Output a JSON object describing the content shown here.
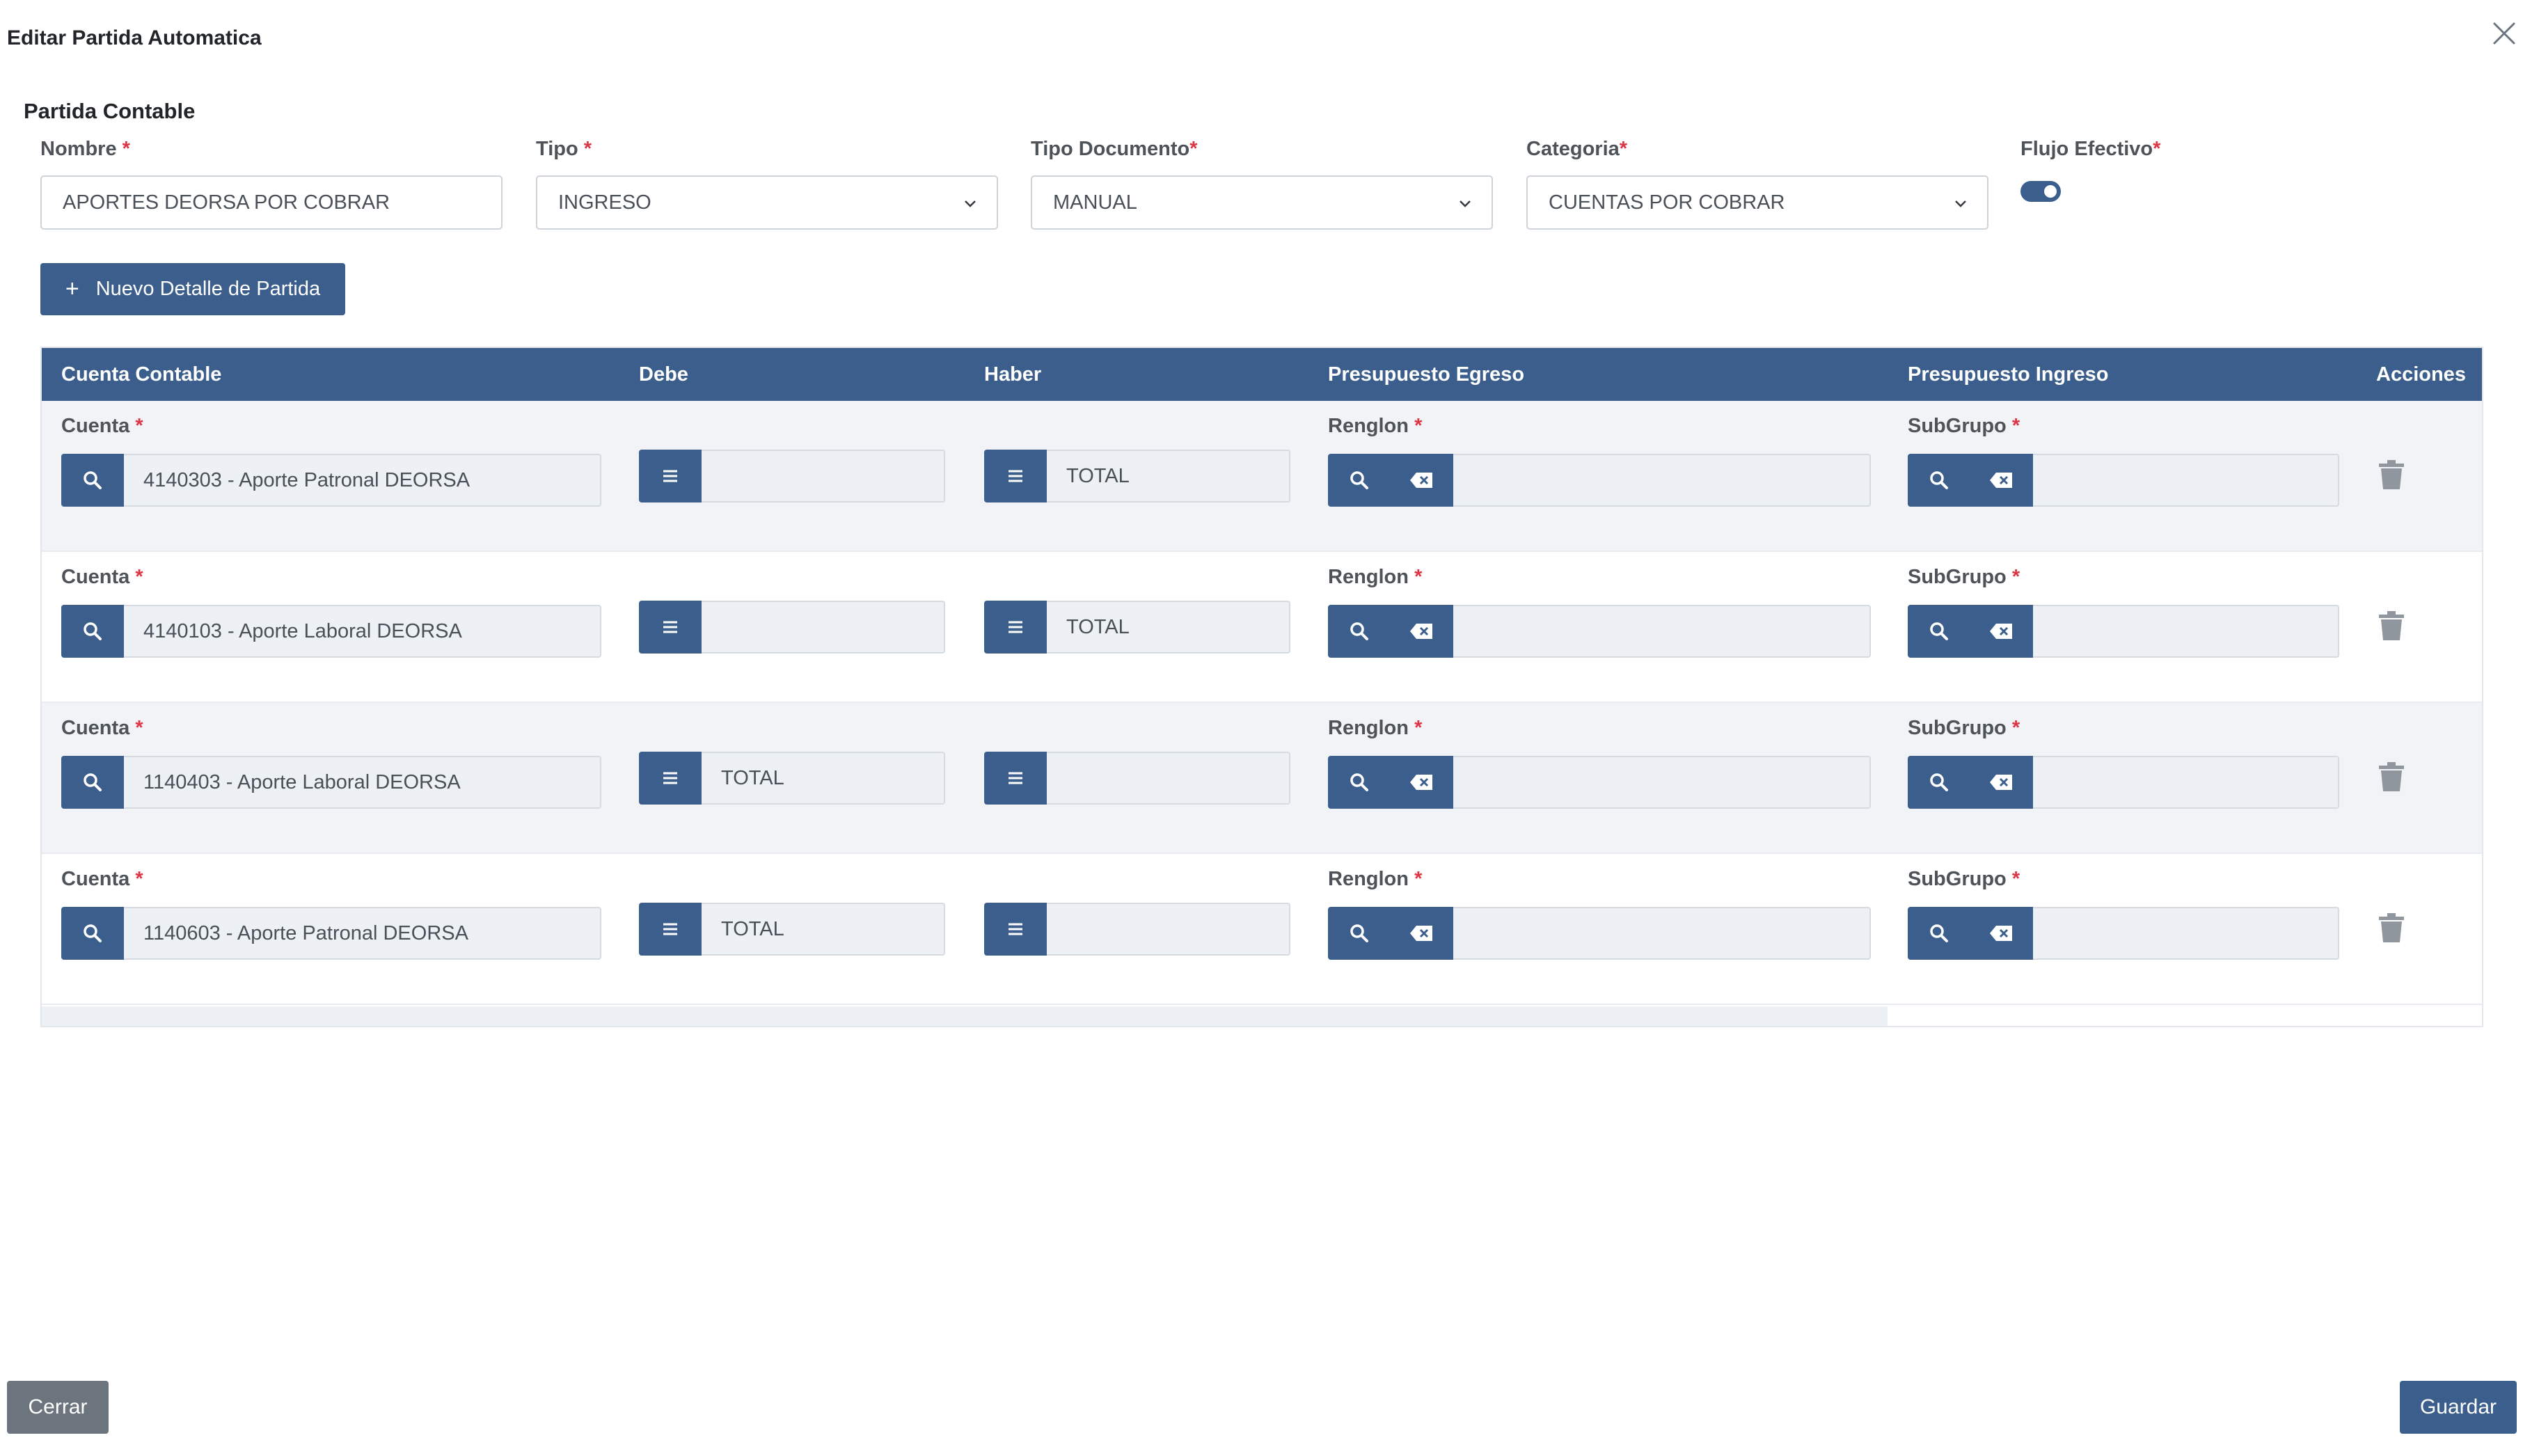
{
  "modal": {
    "title": "Editar Partida Automatica"
  },
  "section": {
    "title": "Partida Contable"
  },
  "form": {
    "nombre": {
      "label": "Nombre",
      "value": "APORTES DEORSA POR COBRAR"
    },
    "tipo": {
      "label": "Tipo",
      "value": "INGRESO"
    },
    "tipo_documento": {
      "label": "Tipo Documento",
      "value": "MANUAL"
    },
    "categoria": {
      "label": "Categoria",
      "value": "CUENTAS POR COBRAR"
    },
    "flujo_efectivo": {
      "label": "Flujo Efectivo",
      "checked": true
    },
    "required_mark": "*"
  },
  "actions": {
    "new_detail": "Nuevo Detalle de Partida",
    "close": "Cerrar",
    "save": "Guardar"
  },
  "table": {
    "headers": [
      "Cuenta Contable",
      "Debe",
      "Haber",
      "Presupuesto Egreso",
      "Presupuesto Ingreso",
      "Acciones"
    ],
    "labels": {
      "cuenta": "Cuenta",
      "renglon": "Renglon",
      "subgrupo": "SubGrupo"
    },
    "rows": [
      {
        "cuenta": "4140303 - Aporte Patronal DEORSA",
        "debe": "",
        "haber": "TOTAL",
        "renglon": "",
        "subgrupo": ""
      },
      {
        "cuenta": "4140103 - Aporte Laboral DEORSA",
        "debe": "",
        "haber": "TOTAL",
        "renglon": "",
        "subgrupo": ""
      },
      {
        "cuenta": "1140403 - Aporte Laboral DEORSA",
        "debe": "TOTAL",
        "haber": "",
        "renglon": "",
        "subgrupo": ""
      },
      {
        "cuenta": "1140603 - Aporte Patronal DEORSA",
        "debe": "TOTAL",
        "haber": "",
        "renglon": "",
        "subgrupo": ""
      }
    ]
  },
  "colors": {
    "primary": "#3b5e8c",
    "secondary": "#6c757d",
    "required": "#dc3545",
    "row_shade": "#f1f3f6"
  },
  "icons": [
    "close-icon",
    "chevron-down-icon",
    "plus-icon",
    "search-icon",
    "menu-icon",
    "backspace-icon",
    "trash-icon"
  ]
}
